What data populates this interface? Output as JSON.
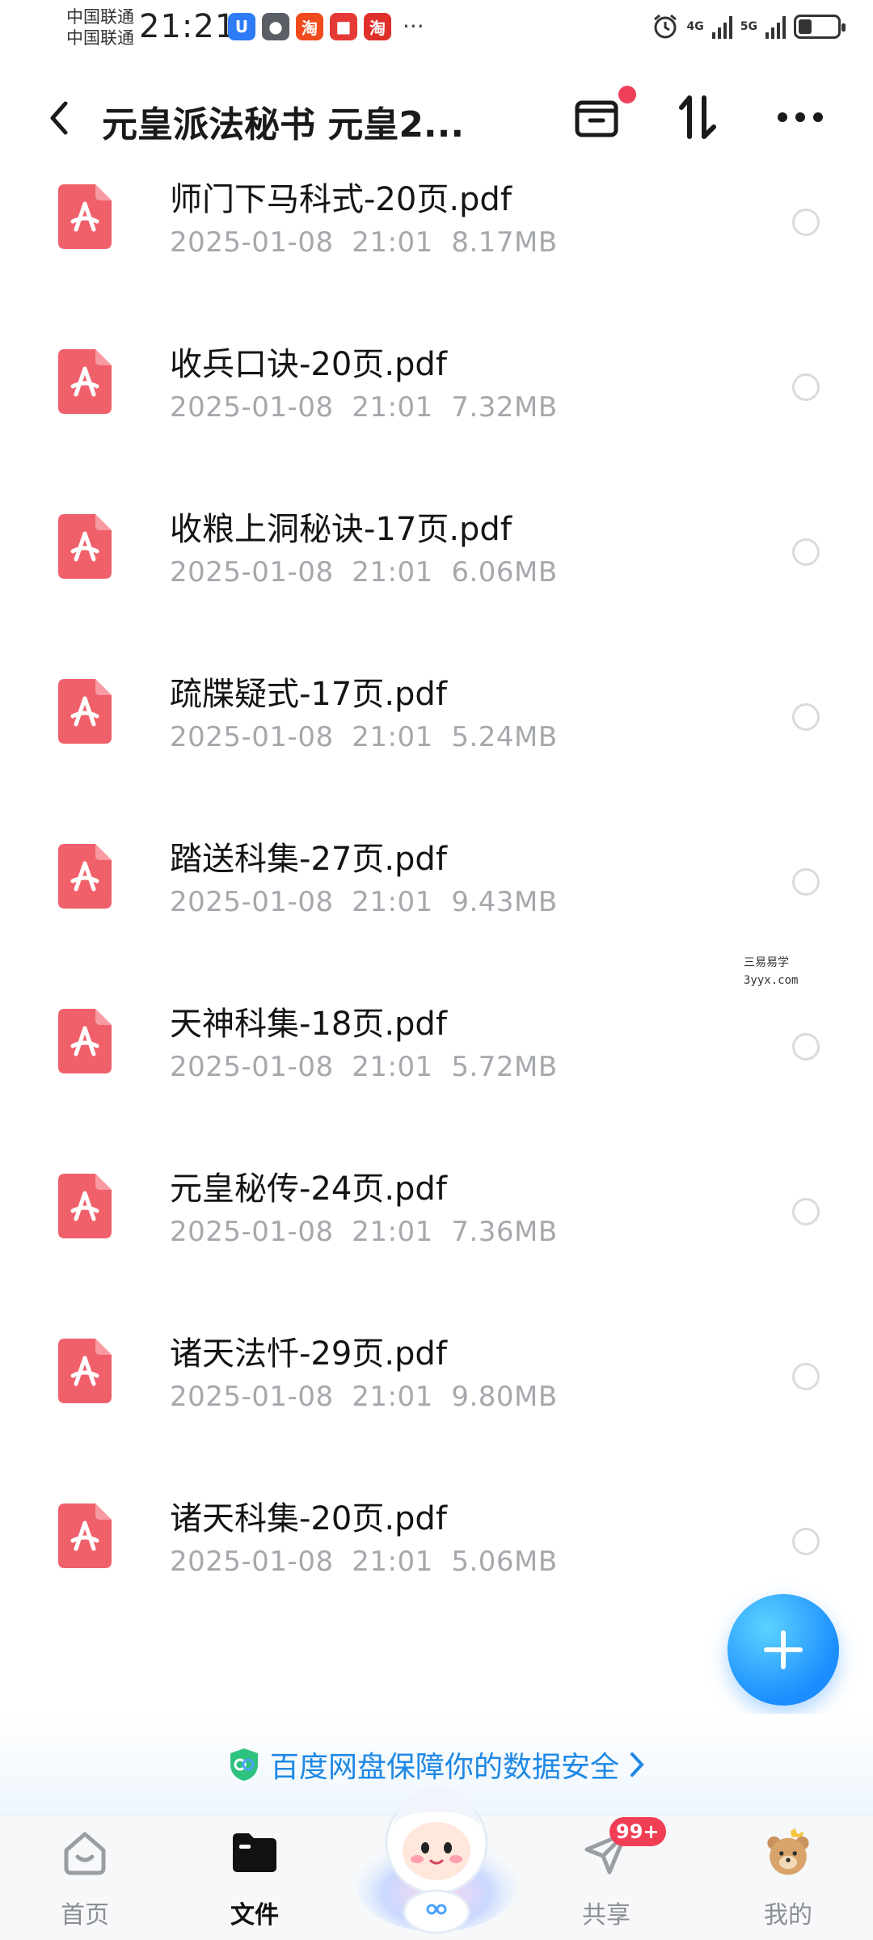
{
  "status_bar": {
    "carrier1": "中国联通",
    "carrier2": "中国联通",
    "time": "21:21",
    "apps": [
      {
        "icon": "uc-icon",
        "glyph": "U",
        "color": "#2d7cf6"
      },
      {
        "icon": "wechat-icon",
        "glyph": "●",
        "color": "#5a5f66"
      },
      {
        "icon": "taobao-icon",
        "glyph": "淘",
        "color": "#f04a1d"
      },
      {
        "icon": "book-icon",
        "glyph": "■",
        "color": "#e53935"
      },
      {
        "icon": "taobao-icon",
        "glyph": "淘",
        "color": "#e0302b"
      }
    ],
    "more": "···",
    "net1": "4G",
    "net2": "5G",
    "battery_level": 0.35
  },
  "header": {
    "title": "元皇派法秘书 元皇2..."
  },
  "files": [
    {
      "name": "师门下马科式-20页.pdf",
      "date": "2025-01-08",
      "time": "21:01",
      "size": "8.17MB"
    },
    {
      "name": "收兵口诀-20页.pdf",
      "date": "2025-01-08",
      "time": "21:01",
      "size": "7.32MB"
    },
    {
      "name": "收粮上洞秘诀-17页.pdf",
      "date": "2025-01-08",
      "time": "21:01",
      "size": "6.06MB"
    },
    {
      "name": "疏牒疑式-17页.pdf",
      "date": "2025-01-08",
      "time": "21:01",
      "size": "5.24MB"
    },
    {
      "name": "踏送科集-27页.pdf",
      "date": "2025-01-08",
      "time": "21:01",
      "size": "9.43MB"
    },
    {
      "name": "天神科集-18页.pdf",
      "date": "2025-01-08",
      "time": "21:01",
      "size": "5.72MB"
    },
    {
      "name": "元皇秘传-24页.pdf",
      "date": "2025-01-08",
      "time": "21:01",
      "size": "7.36MB"
    },
    {
      "name": "诸天法忏-29页.pdf",
      "date": "2025-01-08",
      "time": "21:01",
      "size": "9.80MB"
    },
    {
      "name": "诸天科集-20页.pdf",
      "date": "2025-01-08",
      "time": "21:01",
      "size": "5.06MB"
    }
  ],
  "watermark": {
    "line1": "三易易学",
    "line2": "3yyx.com"
  },
  "banner": {
    "text": "百度网盘保障你的数据安全"
  },
  "tabs": {
    "home": "首页",
    "files": "文件",
    "share": "共享",
    "share_badge": "99+",
    "mine": "我的"
  },
  "colors": {
    "pdf_red": "#f0606b",
    "accent_blue": "#1e88e5",
    "badge_red": "#f03f55"
  }
}
